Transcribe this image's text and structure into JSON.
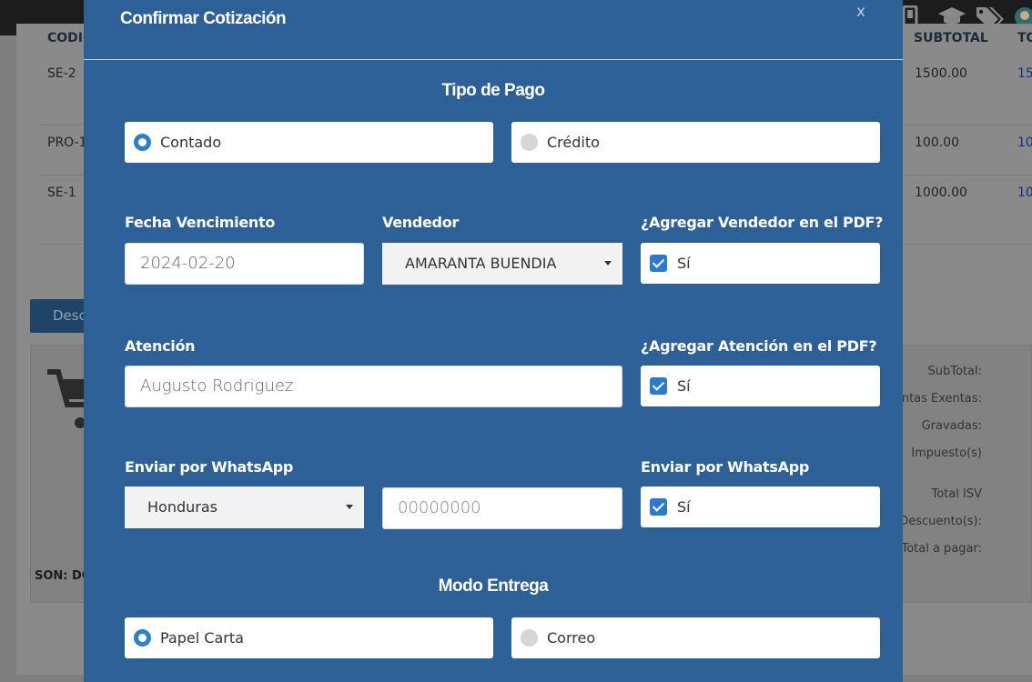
{
  "background": {
    "table": {
      "headers": {
        "codigo": "CODIGO",
        "subtotal": "SUBTOTAL",
        "total": "TO"
      },
      "rows": [
        {
          "code": "SE-2",
          "subtotal": "1500.00",
          "total": "15"
        },
        {
          "code": "PRO-1",
          "subtotal": "100.00",
          "total": "10"
        },
        {
          "code": "SE-1",
          "subtotal": "1000.00",
          "total": "10"
        }
      ]
    },
    "discount_button": "Desc",
    "summary": {
      "subtotal": "SubTotal:",
      "exentas": "entas Exentas:",
      "gravadas": "Gravadas:",
      "impuestos": "Impuesto(s)",
      "total_isv": "Total ISV",
      "descuentos": "Descuento(s):",
      "total_pagar": "Total a pagar:"
    },
    "son": "SON: DO"
  },
  "modal": {
    "title": "Confirmar Cotización",
    "close": "x",
    "tipo_pago": {
      "title": "Tipo de Pago",
      "options": [
        {
          "label": "Contado",
          "selected": true
        },
        {
          "label": "Crédito",
          "selected": false
        }
      ]
    },
    "fecha_vencimiento": {
      "label": "Fecha Vencimiento",
      "value": "2024-02-20"
    },
    "vendedor": {
      "label": "Vendedor",
      "value": "AMARANTA BUENDIA"
    },
    "agregar_vendedor": {
      "label": "¿Agregar Vendedor en el PDF?",
      "checked": true,
      "text": "Sí"
    },
    "atencion": {
      "label": "Atención",
      "value": "Augusto Rodriguez"
    },
    "agregar_atencion": {
      "label": "¿Agregar Atención en el PDF?",
      "checked": true,
      "text": "Sí"
    },
    "whatsapp": {
      "label": "Enviar por WhatsApp",
      "country": "Honduras",
      "phone_placeholder": "00000000"
    },
    "whatsapp_check": {
      "label": "Enviar por WhatsApp",
      "checked": true,
      "text": "Sí"
    },
    "modo_entrega": {
      "title": "Modo Entrega",
      "options": [
        {
          "label": "Papel Carta",
          "selected": true
        },
        {
          "label": "Correo",
          "selected": false
        }
      ]
    }
  },
  "colors": {
    "modal_bg": "#2e6098",
    "accent": "#2f81c7",
    "checkbox": "#2b7ad0"
  }
}
